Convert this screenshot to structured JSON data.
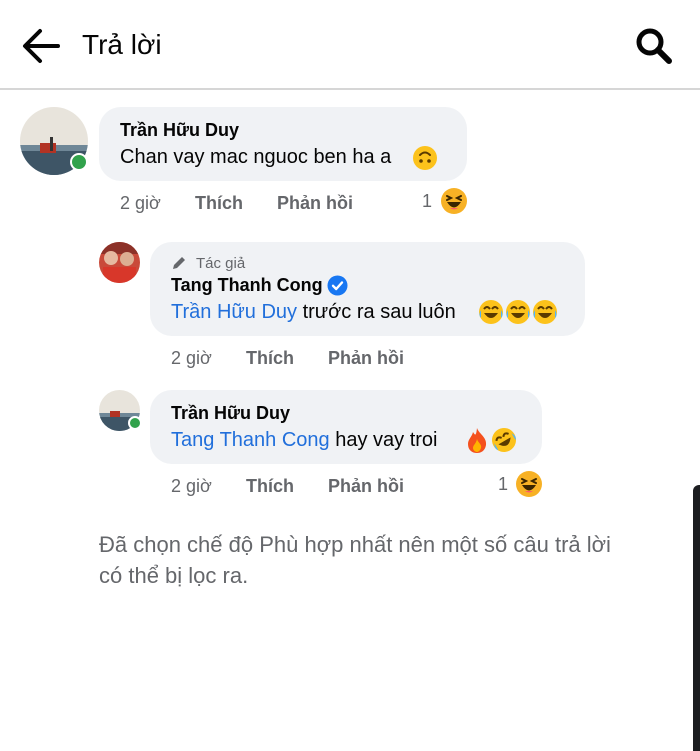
{
  "header": {
    "title": "Trả lời"
  },
  "comment": {
    "author": "Trần Hữu Duy",
    "text": "Chan vay mac nguoc ben ha a",
    "time": "2 giờ",
    "like_label": "Thích",
    "reply_label": "Phản hồi",
    "reaction_count": "1",
    "reaction_icon": "haha-emoji"
  },
  "replies": [
    {
      "author_tag": "Tác giả",
      "author": "Tang Thanh Cong",
      "verified": true,
      "mention": "Trần Hữu Duy",
      "text": " trước ra sau luôn",
      "time": "2 giờ",
      "like_label": "Thích",
      "reply_label": "Phản hồi"
    },
    {
      "author": "Trần Hữu Duy",
      "mention": "Tang Thanh Cong",
      "text": " hay vay troi",
      "time": "2 giờ",
      "like_label": "Thích",
      "reply_label": "Phản hồi",
      "reaction_count": "1",
      "reaction_icon": "haha-emoji"
    }
  ],
  "notice": "Đã chọn chế độ Phù hợp nhất nên một số câu trả lời có thể bị lọc ra.",
  "colors": {
    "link": "#216fdb",
    "bubble": "#f0f2f5",
    "online": "#31a24c",
    "verified": "#1877f2"
  }
}
